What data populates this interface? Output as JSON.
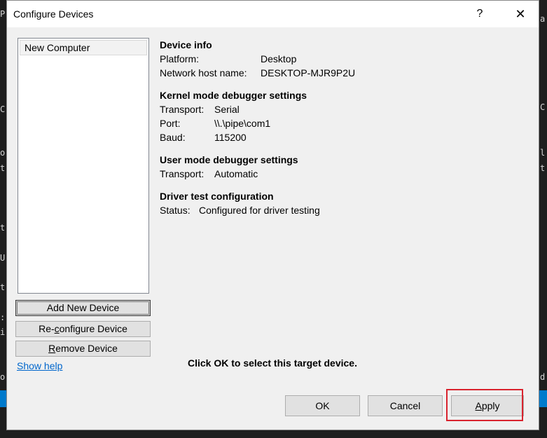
{
  "window": {
    "title": "Configure Devices",
    "help_glyph": "?",
    "close_glyph": "✕"
  },
  "device_list": {
    "items": [
      "New Computer"
    ]
  },
  "buttons": {
    "add_device": "Add New Device",
    "reconfigure_prefix": "Re-",
    "reconfigure_mnemonic": "c",
    "reconfigure_suffix": "onfigure Device",
    "remove_mnemonic": "R",
    "remove_suffix": "emove Device",
    "ok": "OK",
    "cancel": "Cancel",
    "apply_mnemonic": "A",
    "apply_suffix": "pply"
  },
  "show_help": "Show help",
  "device_info": {
    "heading": "Device info",
    "platform_label": "Platform:",
    "platform_value": "Desktop",
    "host_label": "Network host name:",
    "host_value": "DESKTOP-MJR9P2U"
  },
  "kernel": {
    "heading": "Kernel mode debugger settings",
    "transport_label": "Transport:",
    "transport_value": "Serial",
    "port_label": "Port:",
    "port_value": "\\\\.\\pipe\\com1",
    "baud_label": "Baud:",
    "baud_value": "115200"
  },
  "user_mode": {
    "heading": "User mode debugger settings",
    "transport_label": "Transport:",
    "transport_value": "Automatic"
  },
  "driver_test": {
    "heading": "Driver test configuration",
    "status_label": "Status:",
    "status_value": "Configured for driver testing"
  },
  "hint": "Click OK to select this target device.",
  "background_glyphs": {
    "left": [
      "P",
      "C",
      "o",
      "t",
      "t",
      "U",
      "t",
      ":",
      "i",
      "o"
    ],
    "right": [
      "a",
      "C",
      "l",
      "t",
      "d"
    ]
  },
  "colors": {
    "highlight": "#d9232e",
    "link": "#0066cc",
    "ide_accent": "#007acc"
  }
}
